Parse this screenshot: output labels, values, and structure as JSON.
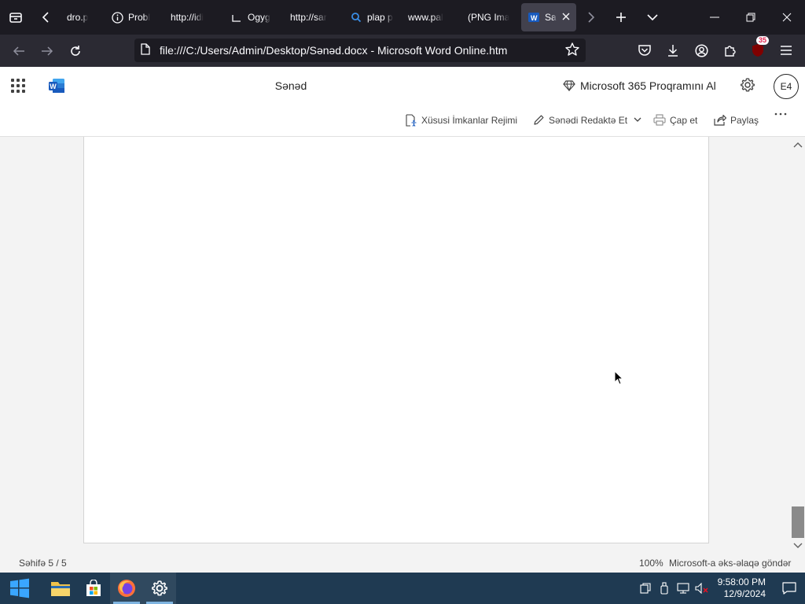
{
  "browser": {
    "tabs": [
      {
        "label": "dro.p",
        "icon": "none"
      },
      {
        "label": "Probl",
        "icon": "info-icon"
      },
      {
        "label": "http://idi",
        "icon": "none"
      },
      {
        "label": "Ogyg",
        "icon": "page-icon"
      },
      {
        "label": "http://sar",
        "icon": "none"
      },
      {
        "label": "plap p",
        "icon": "search-icon"
      },
      {
        "label": "www.pal",
        "icon": "none"
      },
      {
        "label": "(PNG Ima",
        "icon": "none"
      },
      {
        "label": "Sa",
        "icon": "word-icon",
        "active": true
      }
    ],
    "url": "file:///C:/Users/Admin/Desktop/Sənəd.docx - Microsoft Word Online.htm",
    "extension_badge": "35"
  },
  "word": {
    "doc_title": "Sənəd",
    "m365_label": "Microsoft 365 Proqramını Al",
    "avatar_initials": "E4",
    "commands": {
      "accessibility": "Xüsusi İmkanlar Rejimi",
      "edit": "Sənədi Redaktə Et",
      "print": "Çap et",
      "share": "Paylaş"
    },
    "status": {
      "page": "Səhifə 5 / 5",
      "zoom": "100%",
      "feedback": "Microsoft-a əks-əlaqə göndər"
    }
  },
  "taskbar": {
    "time": "9:58:00 PM",
    "date": "12/9/2024"
  },
  "colors": {
    "taskbar": "#1f3a52",
    "browser_bg": "#1c1b22",
    "word_blue": "#185abd"
  }
}
